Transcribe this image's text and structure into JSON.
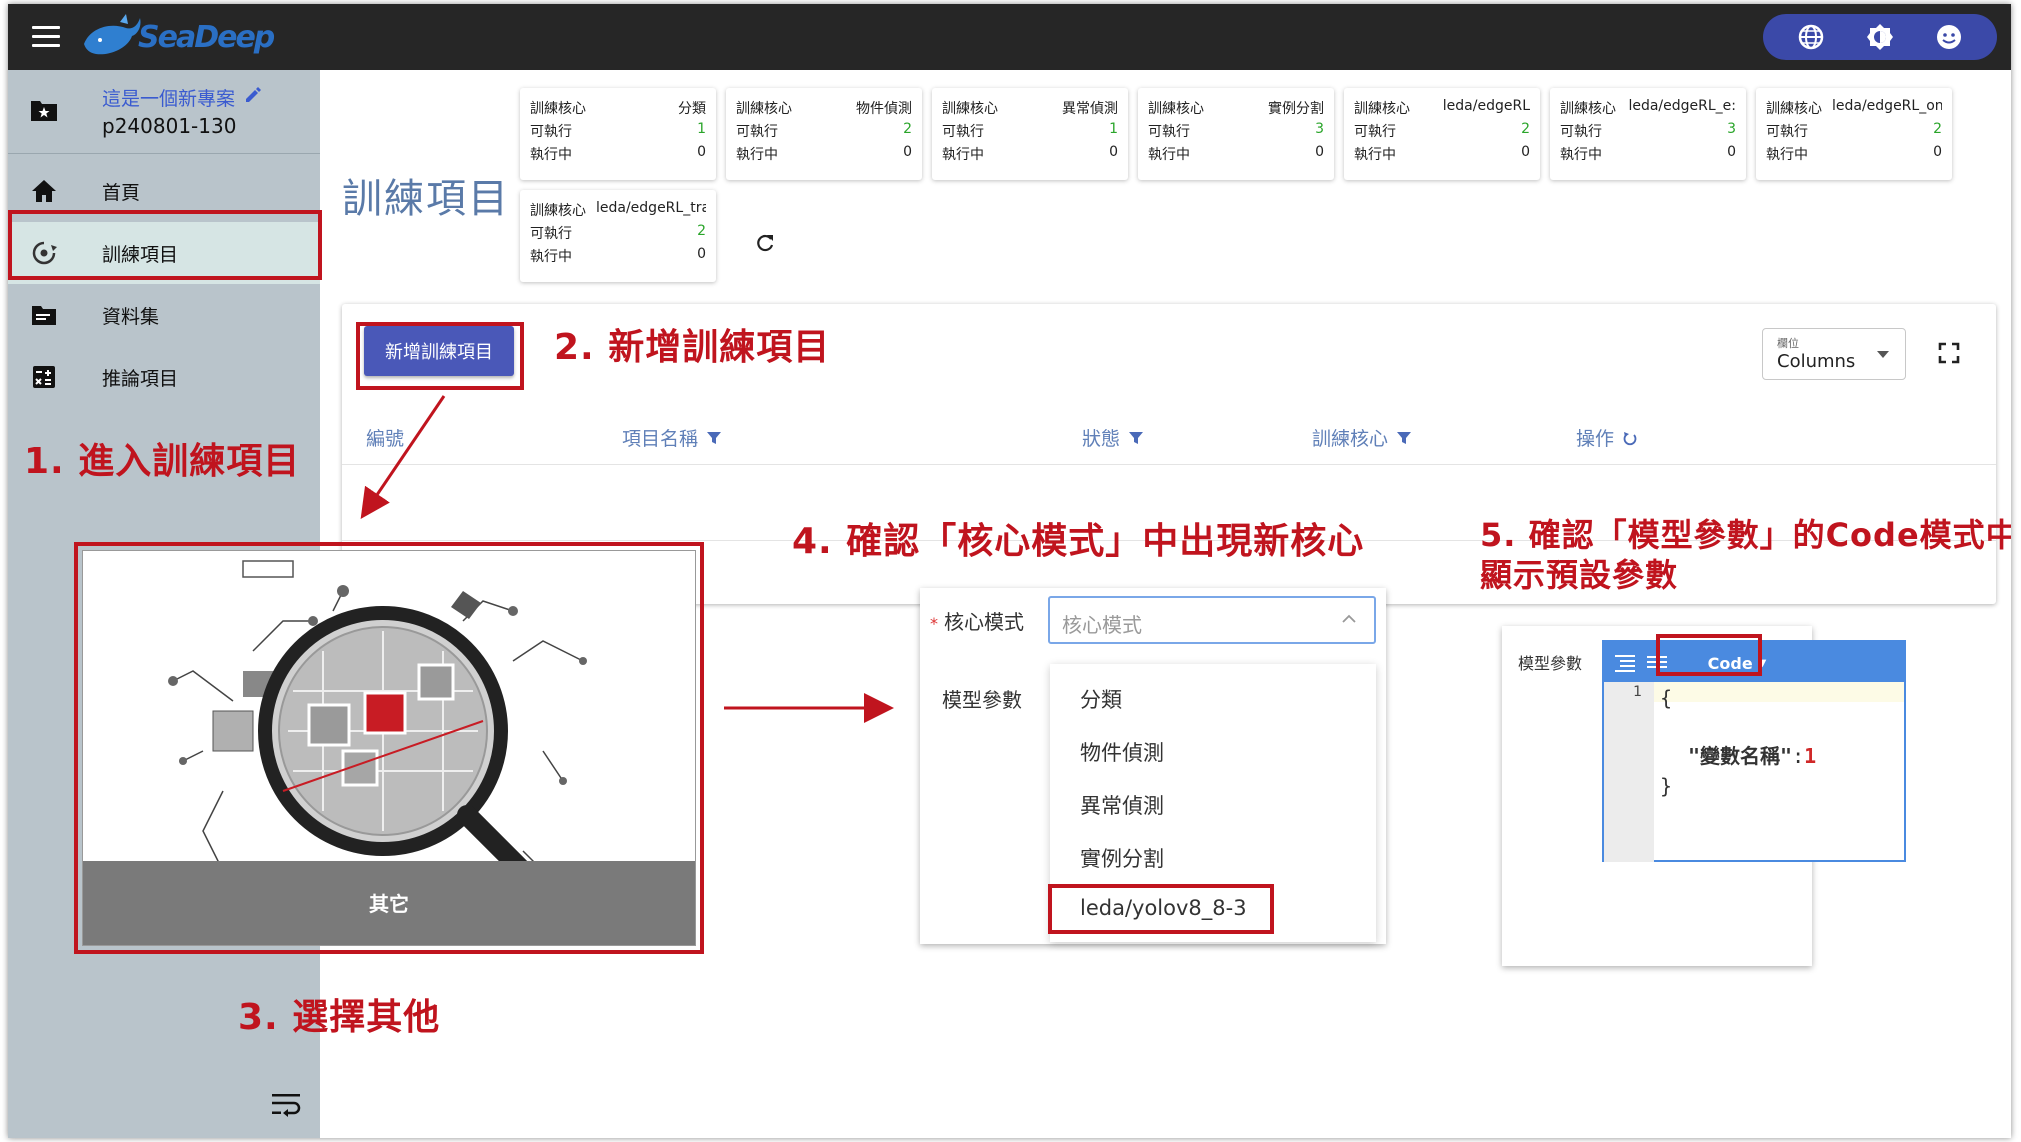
{
  "app": {
    "logo_text": "SeaDeep"
  },
  "sidebar": {
    "project_name": "這是一個新專案",
    "project_id": "p240801-130",
    "items": [
      {
        "label": "首頁",
        "icon": "home-icon"
      },
      {
        "label": "訓練項目",
        "icon": "training-icon"
      },
      {
        "label": "資料集",
        "icon": "dataset-icon"
      },
      {
        "label": "推論項目",
        "icon": "calculator-icon"
      }
    ]
  },
  "main": {
    "title": "訓練項目",
    "stat_row_labels": {
      "kernel": "訓練核心",
      "runnable": "可執行",
      "running": "執行中"
    },
    "stat_cards": [
      {
        "name": "分類",
        "runnable": "1",
        "running": "0"
      },
      {
        "name": "物件偵測",
        "runnable": "2",
        "running": "0"
      },
      {
        "name": "異常偵測",
        "runnable": "1",
        "running": "0"
      },
      {
        "name": "實例分割",
        "runnable": "3",
        "running": "0"
      },
      {
        "name": "leda/edgeRL",
        "runnable": "2",
        "running": "0"
      },
      {
        "name": "leda/edgeRL_e:",
        "runnable": "3",
        "running": "0"
      },
      {
        "name": "leda/edgeRL_onnx",
        "runnable": "2",
        "running": "0"
      },
      {
        "name": "leda/edgeRL_train",
        "runnable": "2",
        "running": "0"
      }
    ],
    "add_button": "新增訓練項目",
    "columns_select": {
      "label": "欄位",
      "value": "Columns"
    },
    "table_headers": [
      "編號",
      "項目名稱",
      "狀態",
      "訓練核心",
      "操作"
    ]
  },
  "category_card": {
    "caption": "其它"
  },
  "kernel_form": {
    "kernel_label": "核心模式",
    "kernel_placeholder": "核心模式",
    "params_label": "模型參數",
    "options": [
      "分類",
      "物件偵測",
      "異常偵測",
      "實例分割",
      "leda/yolov8_8-3"
    ]
  },
  "code_panel": {
    "label": "模型參數",
    "mode": "Code",
    "line_number": "1",
    "open_brace": "{",
    "key": "\"變數名稱\"",
    "colon": ":",
    "value": "1",
    "close_brace": "}"
  },
  "annotations": {
    "step1": "1. 進入訓練項目",
    "step2": "2. 新增訓練項目",
    "step3": "3. 選擇其他",
    "step4": "4. 確認「核心模式」中出現新核心",
    "step5_line1": "5. 確認「模型參數」的Code模式中",
    "step5_line2": "顯示預設參數"
  },
  "colors": {
    "topbar": "#262626",
    "sidebar": "#b9c4cb",
    "accent": "#4a58b8",
    "annotation": "#c0141e",
    "runnable_green": "#2aa52a"
  }
}
